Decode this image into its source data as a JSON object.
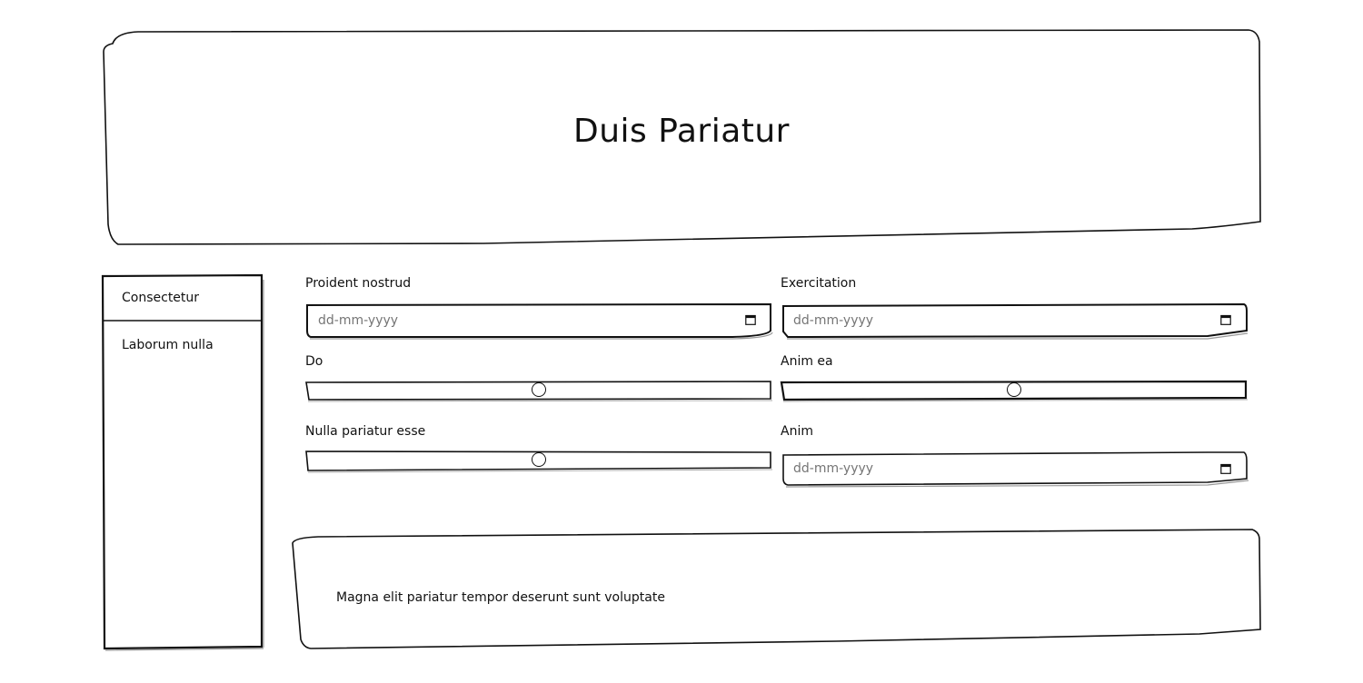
{
  "header": {
    "title": "Duis Pariatur"
  },
  "sidebar": {
    "items": [
      {
        "label": "Consectetur"
      },
      {
        "label": "Laborum nulla"
      }
    ]
  },
  "form": {
    "fields": [
      {
        "label": "Proident nostrud",
        "type": "date",
        "placeholder": "dd-mm-yyyy"
      },
      {
        "label": "Exercitation",
        "type": "date",
        "placeholder": "dd-mm-yyyy"
      },
      {
        "label": "Do",
        "type": "range",
        "value_fraction": 0.5
      },
      {
        "label": "Anim ea",
        "type": "range",
        "value_fraction": 0.5
      },
      {
        "label": "Nulla pariatur esse",
        "type": "range",
        "value_fraction": 0.5
      },
      {
        "label": "Anim",
        "type": "date",
        "placeholder": "dd-mm-yyyy"
      }
    ]
  },
  "footer": {
    "text": "Magna elit pariatur tempor deserunt sunt voluptate"
  },
  "icons": {
    "date": "calendar-icon"
  },
  "colors": {
    "stroke": "#111111",
    "background": "#ffffff"
  }
}
